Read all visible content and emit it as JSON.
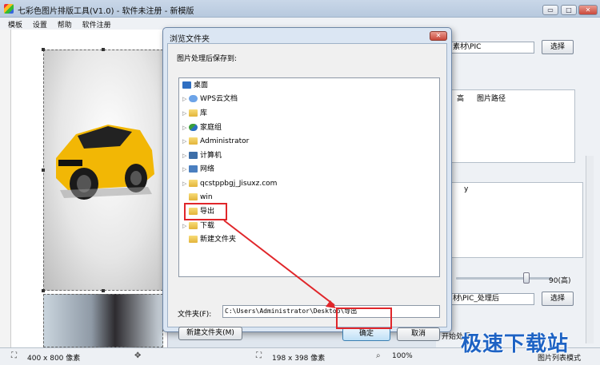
{
  "window": {
    "title": "七彩色图片排版工具(V1.0) - 软件未注册 - 新模版",
    "min_glyph": "▭",
    "max_glyph": "□",
    "close_glyph": "✕"
  },
  "menu": [
    "模板",
    "设置",
    "帮助",
    "软件注册"
  ],
  "right_panel": {
    "path_value": "素材\\PIC",
    "select_label": "选择",
    "grid1_headers": [
      "高",
      "图片路径"
    ],
    "grid2_header": "y",
    "slider_value": "90(高)",
    "output_value": "材\\PIC_处理后",
    "output_select_label": "选择",
    "start_label": "开始处理",
    "list_mode_label": "图片列表模式"
  },
  "status": {
    "size1": "400 x 800 像素",
    "size2": "198 x 398 像素",
    "zoom": "100%"
  },
  "dialog": {
    "title": "浏览文件夹",
    "close_glyph": "✕",
    "prompt": "图片处理后保存到:",
    "tree": [
      {
        "label": "桌面",
        "icon": "desktop-icon",
        "arrow": ""
      },
      {
        "label": "WPS云文档",
        "icon": "cloud-icon",
        "arrow": "▷"
      },
      {
        "label": "库",
        "icon": "library-icon",
        "arrow": "▷"
      },
      {
        "label": "家庭组",
        "icon": "homegroup-icon",
        "arrow": "▷"
      },
      {
        "label": "Administrator",
        "icon": "user-folder-icon",
        "arrow": "▷"
      },
      {
        "label": "计算机",
        "icon": "computer-icon",
        "arrow": "▷"
      },
      {
        "label": "网络",
        "icon": "network-icon",
        "arrow": "▷"
      },
      {
        "label": "qcstppbgj_Jisuxz.com",
        "icon": "folder-icon",
        "arrow": "▷"
      },
      {
        "label": "win",
        "icon": "folder-icon",
        "arrow": ""
      },
      {
        "label": "导出",
        "icon": "folder-icon",
        "arrow": ""
      },
      {
        "label": "下载",
        "icon": "folder-icon",
        "arrow": "▷"
      },
      {
        "label": "新建文件夹",
        "icon": "folder-icon",
        "arrow": ""
      }
    ],
    "folder_label": "文件夹(F):",
    "folder_value": "C:\\Users\\Administrator\\Desktop\\导出",
    "new_folder_label": "新建文件夹(M)",
    "ok_label": "确定",
    "cancel_label": "取消"
  },
  "watermark": "极速下载站",
  "colors": {
    "highlight_red": "#e0262a",
    "selection_blue": "#3c7fb1",
    "watermark_blue": "#1e63c4"
  }
}
